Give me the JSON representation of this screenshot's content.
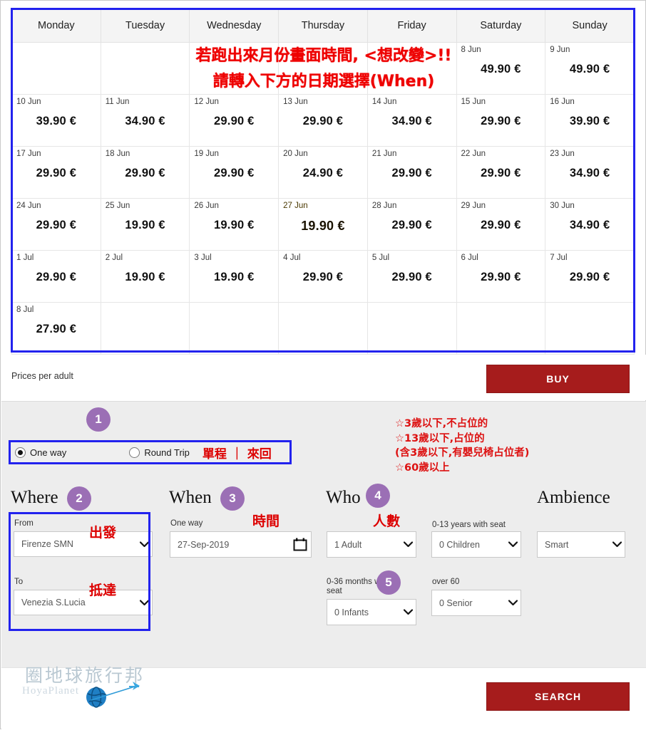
{
  "calendar": {
    "weekdays": [
      "Monday",
      "Tuesday",
      "Wednesday",
      "Thursday",
      "Friday",
      "Saturday",
      "Sunday"
    ],
    "currency": "€",
    "overlay_note_line1": "若跑出來月份畫面時間, <想改變>!!",
    "overlay_note_line2": "請轉入下方的日期選擇(When)",
    "rows": [
      [
        {
          "date": "",
          "price": ""
        },
        {
          "date": "",
          "price": ""
        },
        {
          "date": "",
          "price": ""
        },
        {
          "date": "",
          "price": ""
        },
        {
          "date": "",
          "price": ""
        },
        {
          "date": "8 Jun",
          "price": "49.90 €"
        },
        {
          "date": "9 Jun",
          "price": "49.90 €"
        }
      ],
      [
        {
          "date": "10 Jun",
          "price": "39.90 €"
        },
        {
          "date": "11 Jun",
          "price": "34.90 €"
        },
        {
          "date": "12 Jun",
          "price": "29.90 €"
        },
        {
          "date": "13 Jun",
          "price": "29.90 €"
        },
        {
          "date": "14 Jun",
          "price": "34.90 €"
        },
        {
          "date": "15 Jun",
          "price": "29.90 €"
        },
        {
          "date": "16 Jun",
          "price": "39.90 €"
        }
      ],
      [
        {
          "date": "17 Jun",
          "price": "29.90 €"
        },
        {
          "date": "18 Jun",
          "price": "29.90 €"
        },
        {
          "date": "19 Jun",
          "price": "29.90 €"
        },
        {
          "date": "20 Jun",
          "price": "24.90 €"
        },
        {
          "date": "21 Jun",
          "price": "29.90 €"
        },
        {
          "date": "22 Jun",
          "price": "29.90 €"
        },
        {
          "date": "23 Jun",
          "price": "34.90 €"
        }
      ],
      [
        {
          "date": "24 Jun",
          "price": "29.90 €"
        },
        {
          "date": "25 Jun",
          "price": "19.90 €"
        },
        {
          "date": "26 Jun",
          "price": "19.90 €"
        },
        {
          "date": "27 Jun",
          "price": "19.90 €",
          "selected": true
        },
        {
          "date": "28 Jun",
          "price": "29.90 €"
        },
        {
          "date": "29 Jun",
          "price": "29.90 €"
        },
        {
          "date": "30 Jun",
          "price": "34.90 €"
        }
      ],
      [
        {
          "date": "1 Jul",
          "price": "29.90 €"
        },
        {
          "date": "2 Jul",
          "price": "19.90 €"
        },
        {
          "date": "3 Jul",
          "price": "19.90 €"
        },
        {
          "date": "4 Jul",
          "price": "29.90 €"
        },
        {
          "date": "5 Jul",
          "price": "29.90 €"
        },
        {
          "date": "6 Jul",
          "price": "29.90 €"
        },
        {
          "date": "7 Jul",
          "price": "29.90 €"
        }
      ],
      [
        {
          "date": "8 Jul",
          "price": "27.90 €"
        },
        {
          "date": "",
          "price": ""
        },
        {
          "date": "",
          "price": ""
        },
        {
          "date": "",
          "price": ""
        },
        {
          "date": "",
          "price": ""
        },
        {
          "date": "",
          "price": ""
        },
        {
          "date": "",
          "price": ""
        }
      ]
    ]
  },
  "prices_note": "Prices per adult",
  "buy_button": "BUY",
  "search_button": "SEARCH",
  "badges": {
    "one": "1",
    "two": "2",
    "three": "3",
    "four": "4",
    "five": "5"
  },
  "trip": {
    "one_way_label": "One way",
    "round_trip_label": "Round Trip",
    "one_way_selected": true,
    "annotation": "單程 ｜ 來回"
  },
  "age_notes": [
    "☆3歲以下,不占位的",
    "☆13歲以下,占位的",
    "(含3歲以下,有嬰兒椅占位者)",
    "☆60歲以上"
  ],
  "where": {
    "heading": "Where",
    "from_label": "From",
    "from_value": "Firenze SMN",
    "from_annotation": "出發",
    "to_label": "To",
    "to_value": "Venezia S.Lucia",
    "to_annotation": "抵達"
  },
  "when": {
    "heading": "When",
    "field_label": "One way",
    "date_value": "27-Sep-2019",
    "annotation": "時間"
  },
  "who": {
    "heading": "Who",
    "annotation": "人數",
    "adult_value": "1 Adult",
    "children_label": "0-13 years with seat",
    "children_value": "0 Children",
    "infant_label": "0-36 months without seat",
    "infant_value": "0 Infants",
    "senior_label": "over 60",
    "senior_value": "0 Senior"
  },
  "ambience": {
    "heading": "Ambience",
    "value": "Smart"
  },
  "watermark": {
    "cn": "圈地球旅行邦",
    "en": "HoyaPlanet"
  },
  "colors": {
    "accent_red": "#a61c1c",
    "highlight": "#e8a800",
    "annotation_red": "#dd0000",
    "badge_purple": "#9b6fb5",
    "frame_blue": "#2222ee"
  }
}
